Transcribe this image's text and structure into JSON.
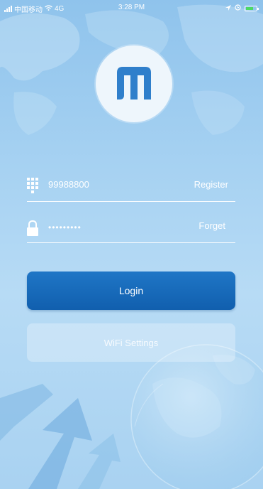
{
  "status_bar": {
    "carrier": "中国移动",
    "network": "4G",
    "time": "3:28 PM"
  },
  "login_form": {
    "account_value": "99988800",
    "account_icon": "keypad-icon",
    "register_label": "Register",
    "password_mask": "•••••••••",
    "password_icon": "lock-icon",
    "forget_label": "Forget"
  },
  "buttons": {
    "login_label": "Login",
    "wifi_settings_label": "WiFi Settings"
  },
  "colors": {
    "background": "#a7d2f2",
    "login_button": "#1669b9",
    "text": "#ffffff"
  }
}
